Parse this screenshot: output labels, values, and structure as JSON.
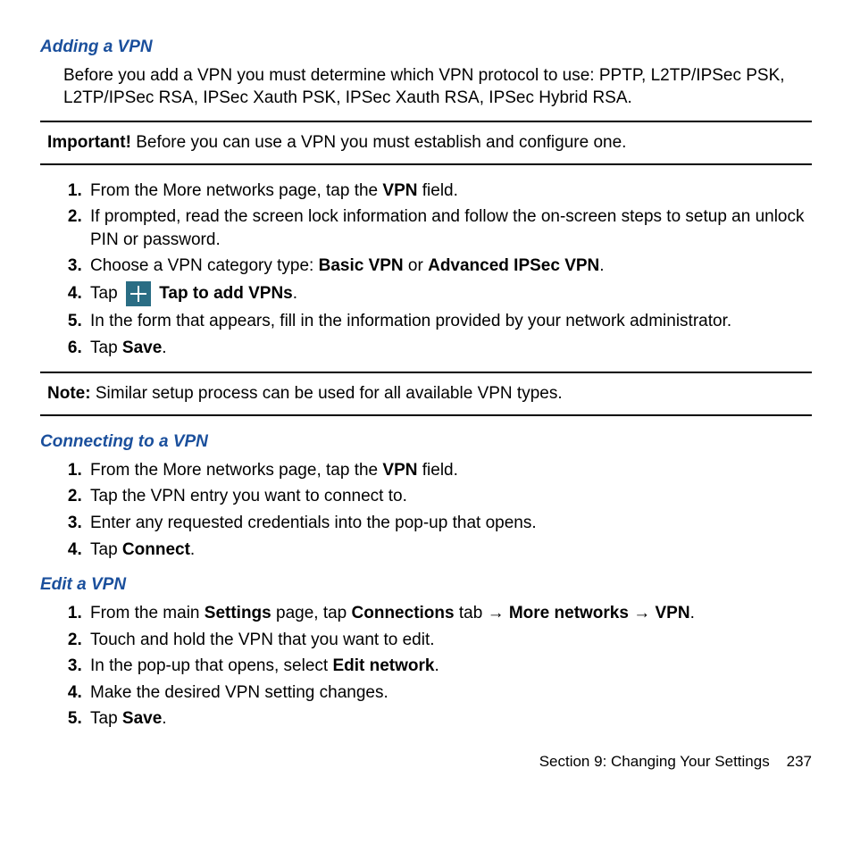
{
  "s1": {
    "title": "Adding a VPN",
    "intro": "Before you add a VPN you must determine which VPN protocol to use: PPTP, L2TP/IPSec PSK, L2TP/IPSec RSA, IPSec Xauth PSK, IPSec Xauth RSA, IPSec Hybrid RSA.",
    "important_label": "Important!",
    "important_text": " Before you can use a VPN you must establish and configure one.",
    "step1a": "From the More networks page, tap the ",
    "step1b": "VPN",
    "step1c": " field.",
    "step2": "If prompted, read the screen lock information and follow the on-screen steps to setup an unlock PIN or password.",
    "step3a": "Choose a VPN category type: ",
    "step3b": "Basic VPN",
    "step3c": " or ",
    "step3d": "Advanced IPSec VPN",
    "step3e": ".",
    "step4a": "Tap ",
    "step4b": "Tap to add VPNs",
    "step4c": ".",
    "step5": "In the form that appears, fill in the information provided by your network administrator.",
    "step6a": "Tap ",
    "step6b": "Save",
    "step6c": ".",
    "note_label": "Note:",
    "note_text": " Similar setup process can be used for all available VPN types."
  },
  "s2": {
    "title": "Connecting to a VPN",
    "step1a": "From the More networks page, tap the ",
    "step1b": "VPN",
    "step1c": " field.",
    "step2": "Tap the VPN entry you want to connect to.",
    "step3": "Enter any requested credentials into the pop-up that opens.",
    "step4a": "Tap ",
    "step4b": "Connect",
    "step4c": "."
  },
  "s3": {
    "title": "Edit a VPN",
    "step1a": "From the main ",
    "step1b": "Settings",
    "step1c": " page, tap ",
    "step1d": "Connections",
    "step1e": " tab ",
    "arrow": "→",
    "step1f": "More networks",
    "step1g": "VPN",
    "step1h": ".",
    "step2": "Touch and hold the VPN that you want to edit.",
    "step3a": "In the pop-up that opens, select ",
    "step3b": "Edit network",
    "step3c": ".",
    "step4": "Make the desired VPN setting changes.",
    "step5a": "Tap ",
    "step5b": "Save",
    "step5c": "."
  },
  "footer": {
    "section": "Section 9:  Changing Your Settings",
    "page": "237"
  }
}
